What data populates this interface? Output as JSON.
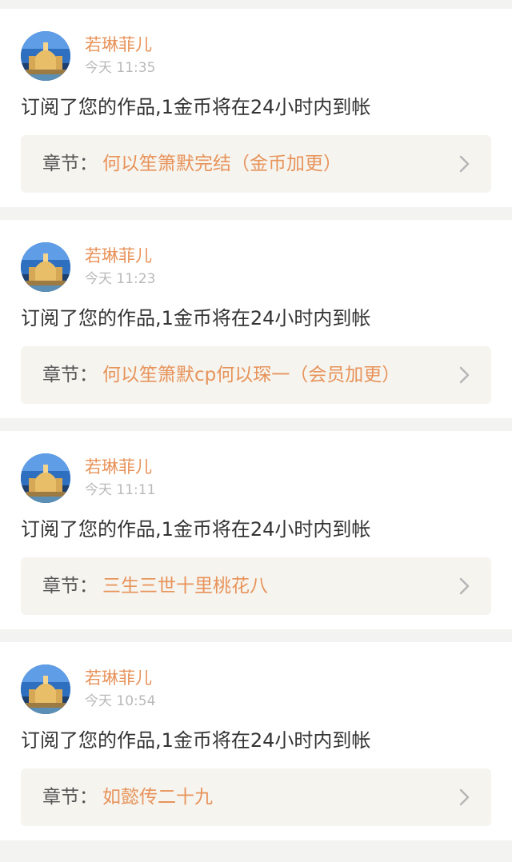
{
  "colors": {
    "accent": "#e8935a",
    "background": "#f3f3f1",
    "card": "#ffffff",
    "chapter_box": "#f5f4ef",
    "time": "#b9b9b9"
  },
  "notifications": [
    {
      "username": "若琳菲儿",
      "time": "今天 11:35",
      "message": "订阅了您的作品,1金币将在24小时内到帐",
      "chapter_prefix": "章节：",
      "chapter_title": "何以笙箫默完结（金币加更）",
      "avatar_icon": "cathedral-avatar-icon",
      "chevron_icon": "chevron-right-icon"
    },
    {
      "username": "若琳菲儿",
      "time": "今天 11:23",
      "message": "订阅了您的作品,1金币将在24小时内到帐",
      "chapter_prefix": "章节：",
      "chapter_title": "何以笙箫默cp何以琛一（会员加更）",
      "avatar_icon": "cathedral-avatar-icon",
      "chevron_icon": "chevron-right-icon"
    },
    {
      "username": "若琳菲儿",
      "time": "今天 11:11",
      "message": "订阅了您的作品,1金币将在24小时内到帐",
      "chapter_prefix": "章节：",
      "chapter_title": "三生三世十里桃花八",
      "avatar_icon": "cathedral-avatar-icon",
      "chevron_icon": "chevron-right-icon"
    },
    {
      "username": "若琳菲儿",
      "time": "今天 10:54",
      "message": "订阅了您的作品,1金币将在24小时内到帐",
      "chapter_prefix": "章节：",
      "chapter_title": "如懿传二十九",
      "avatar_icon": "cathedral-avatar-icon",
      "chevron_icon": "chevron-right-icon"
    }
  ]
}
